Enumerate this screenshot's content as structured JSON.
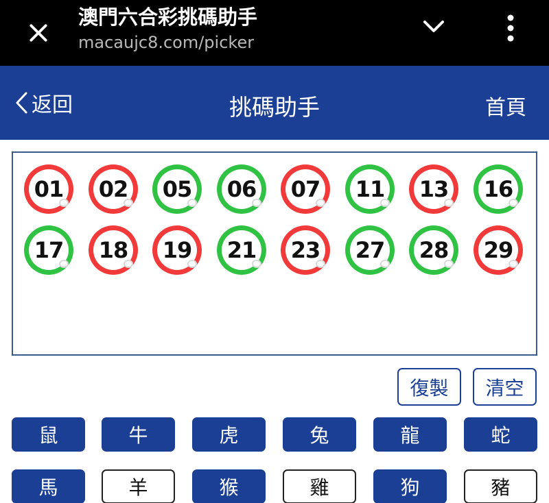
{
  "browser": {
    "title": "澳門六合彩挑碼助手",
    "url": "macaujc8.com/picker",
    "icons": {
      "close": "close-icon",
      "collapse": "chevron-down-icon",
      "menu": "more-vertical-icon"
    }
  },
  "header": {
    "back_label": "返回",
    "title": "挑碼助手",
    "home_label": "首頁"
  },
  "balls": [
    {
      "number": "01",
      "color": "red"
    },
    {
      "number": "02",
      "color": "red"
    },
    {
      "number": "05",
      "color": "green"
    },
    {
      "number": "06",
      "color": "green"
    },
    {
      "number": "07",
      "color": "red"
    },
    {
      "number": "11",
      "color": "green"
    },
    {
      "number": "13",
      "color": "red"
    },
    {
      "number": "16",
      "color": "green"
    },
    {
      "number": "17",
      "color": "green"
    },
    {
      "number": "18",
      "color": "red"
    },
    {
      "number": "19",
      "color": "red"
    },
    {
      "number": "21",
      "color": "green"
    },
    {
      "number": "23",
      "color": "red"
    },
    {
      "number": "27",
      "color": "green"
    },
    {
      "number": "28",
      "color": "green"
    },
    {
      "number": "29",
      "color": "red"
    }
  ],
  "actions": {
    "copy_label": "復製",
    "clear_label": "清空"
  },
  "zodiac": [
    {
      "label": "鼠",
      "selected": true
    },
    {
      "label": "牛",
      "selected": true
    },
    {
      "label": "虎",
      "selected": true
    },
    {
      "label": "兔",
      "selected": true
    },
    {
      "label": "龍",
      "selected": true
    },
    {
      "label": "蛇",
      "selected": true
    },
    {
      "label": "馬",
      "selected": true
    },
    {
      "label": "羊",
      "selected": false
    },
    {
      "label": "猴",
      "selected": true
    },
    {
      "label": "雞",
      "selected": false
    },
    {
      "label": "狗",
      "selected": true
    },
    {
      "label": "豬",
      "selected": false
    }
  ],
  "colors": {
    "brand_blue": "#1a3f95",
    "ball_red": "#f23a3a",
    "ball_green": "#2fc243"
  }
}
